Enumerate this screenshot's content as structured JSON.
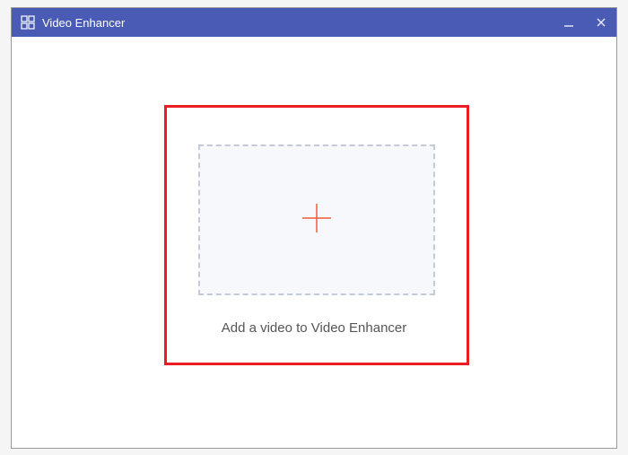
{
  "titlebar": {
    "title": "Video Enhancer"
  },
  "main": {
    "instruction": "Add a video to Video Enhancer"
  }
}
